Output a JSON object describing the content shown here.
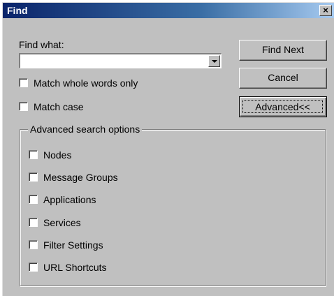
{
  "window": {
    "title": "Find",
    "close_glyph": "×"
  },
  "find_what": {
    "label": "Find what:",
    "value": "",
    "dropdown_icon": "chevron-down-icon"
  },
  "options": {
    "match_whole_words": {
      "label": "Match whole words only",
      "checked": false
    },
    "match_case": {
      "label": "Match case",
      "checked": false
    }
  },
  "buttons": {
    "find_next": "Find Next",
    "cancel": "Cancel",
    "advanced": "Advanced<<"
  },
  "advanced": {
    "legend": "Advanced search options",
    "items": [
      {
        "label": "Nodes",
        "checked": false
      },
      {
        "label": "Message Groups",
        "checked": false
      },
      {
        "label": "Applications",
        "checked": false
      },
      {
        "label": "Services",
        "checked": false
      },
      {
        "label": "Filter Settings",
        "checked": false
      },
      {
        "label": "URL Shortcuts",
        "checked": false
      }
    ]
  }
}
